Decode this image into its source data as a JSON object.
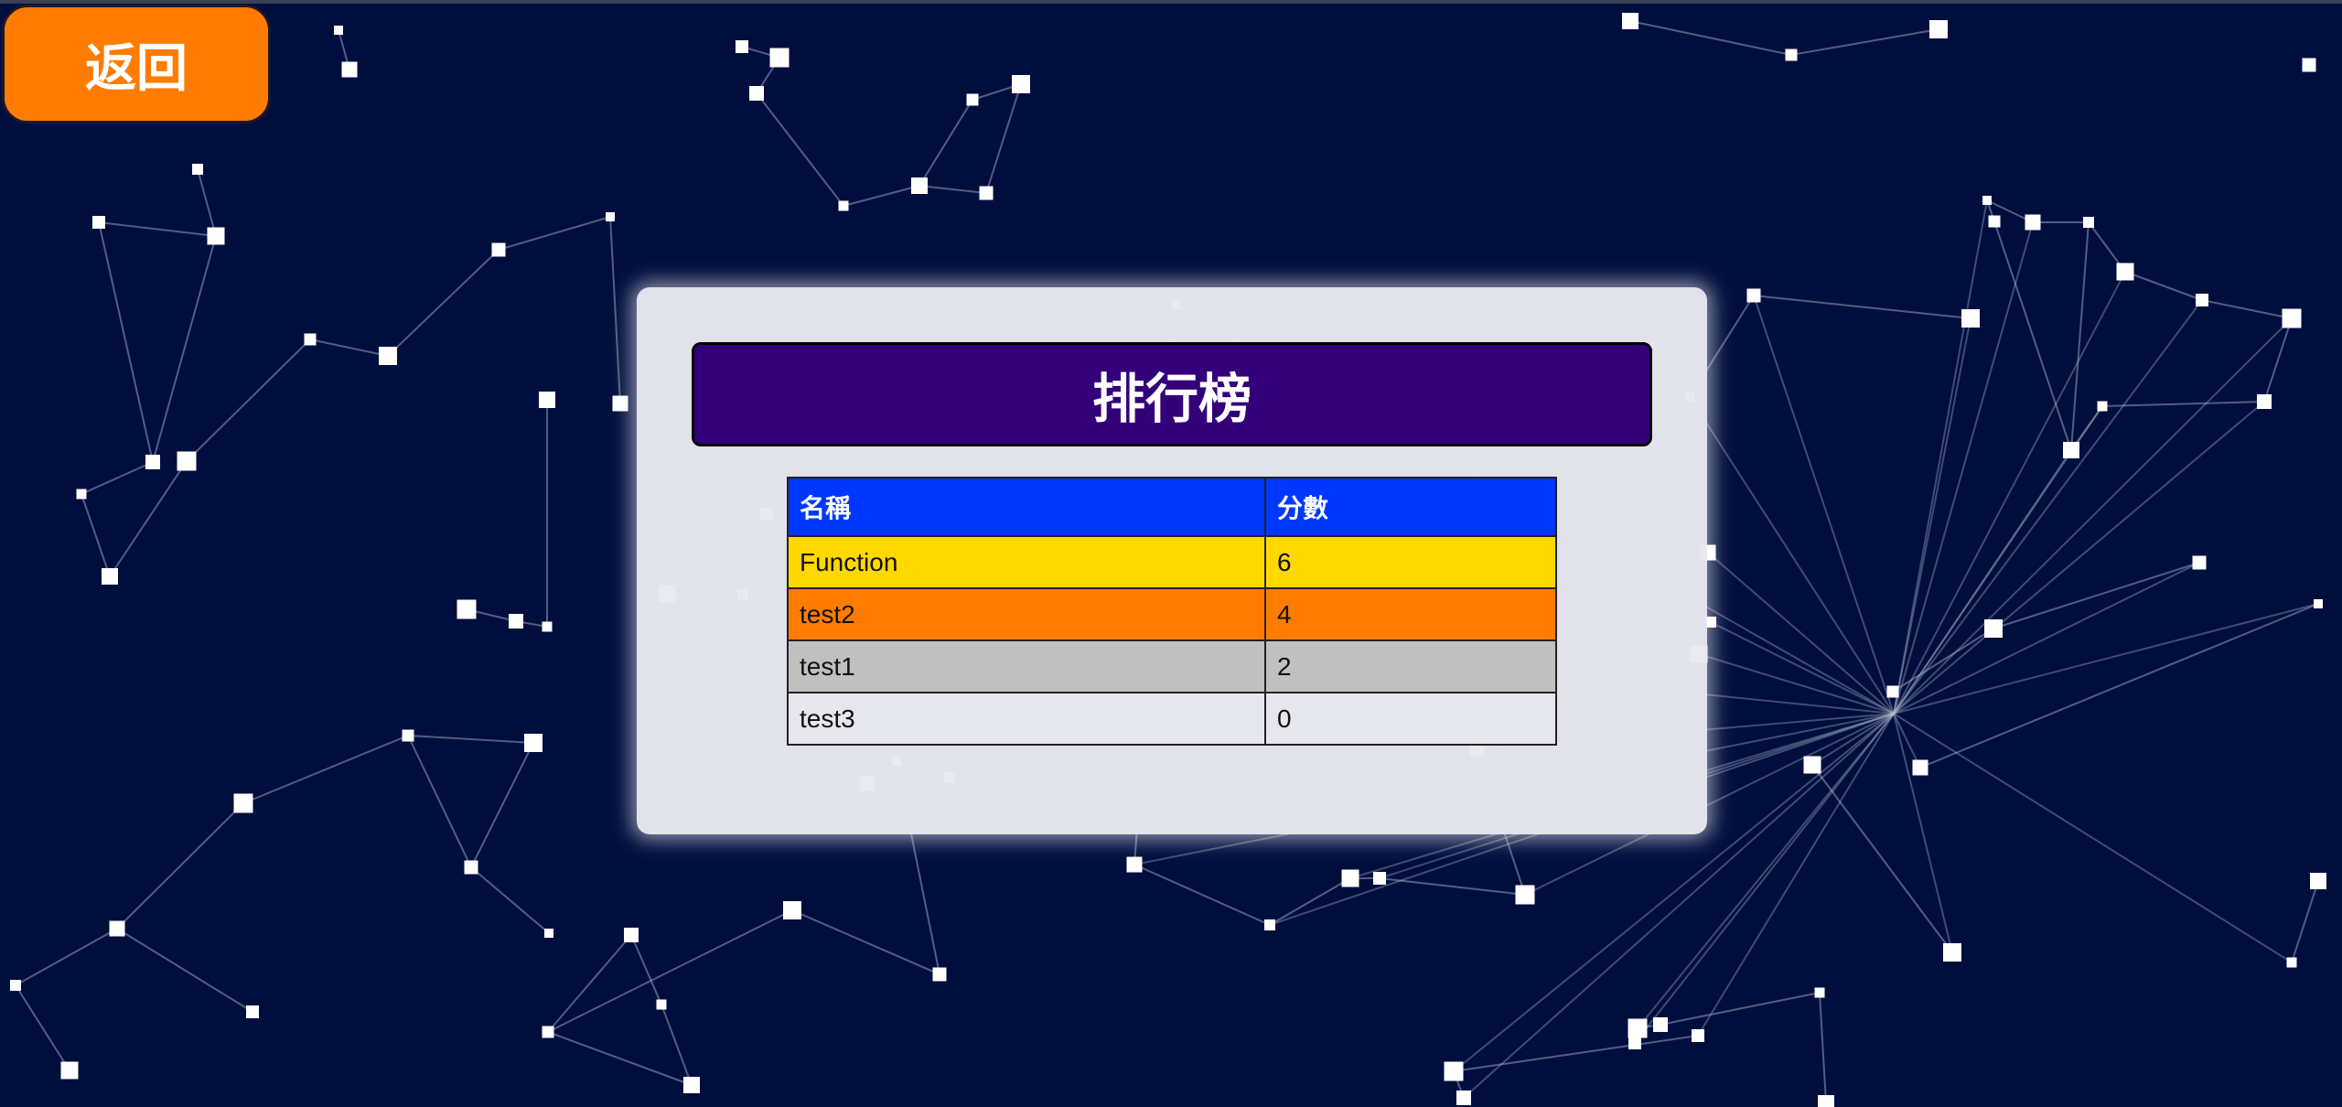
{
  "back_button": {
    "label": "返回"
  },
  "leaderboard": {
    "title": "排行榜",
    "columns": [
      "名稱",
      "分數"
    ],
    "rows": [
      {
        "name": "Function",
        "score": "6",
        "color": "#ffd800"
      },
      {
        "name": "test2",
        "score": "4",
        "color": "#ff7c00"
      },
      {
        "name": "test1",
        "score": "2",
        "color": "#c0c0c0"
      },
      {
        "name": "test3",
        "score": "0",
        "color": "#e6e7ee"
      }
    ]
  },
  "colors": {
    "background": "#000e3e",
    "back_button": "#ff7c00",
    "title_bar": "#34007a",
    "header_row": "#0037ff"
  }
}
